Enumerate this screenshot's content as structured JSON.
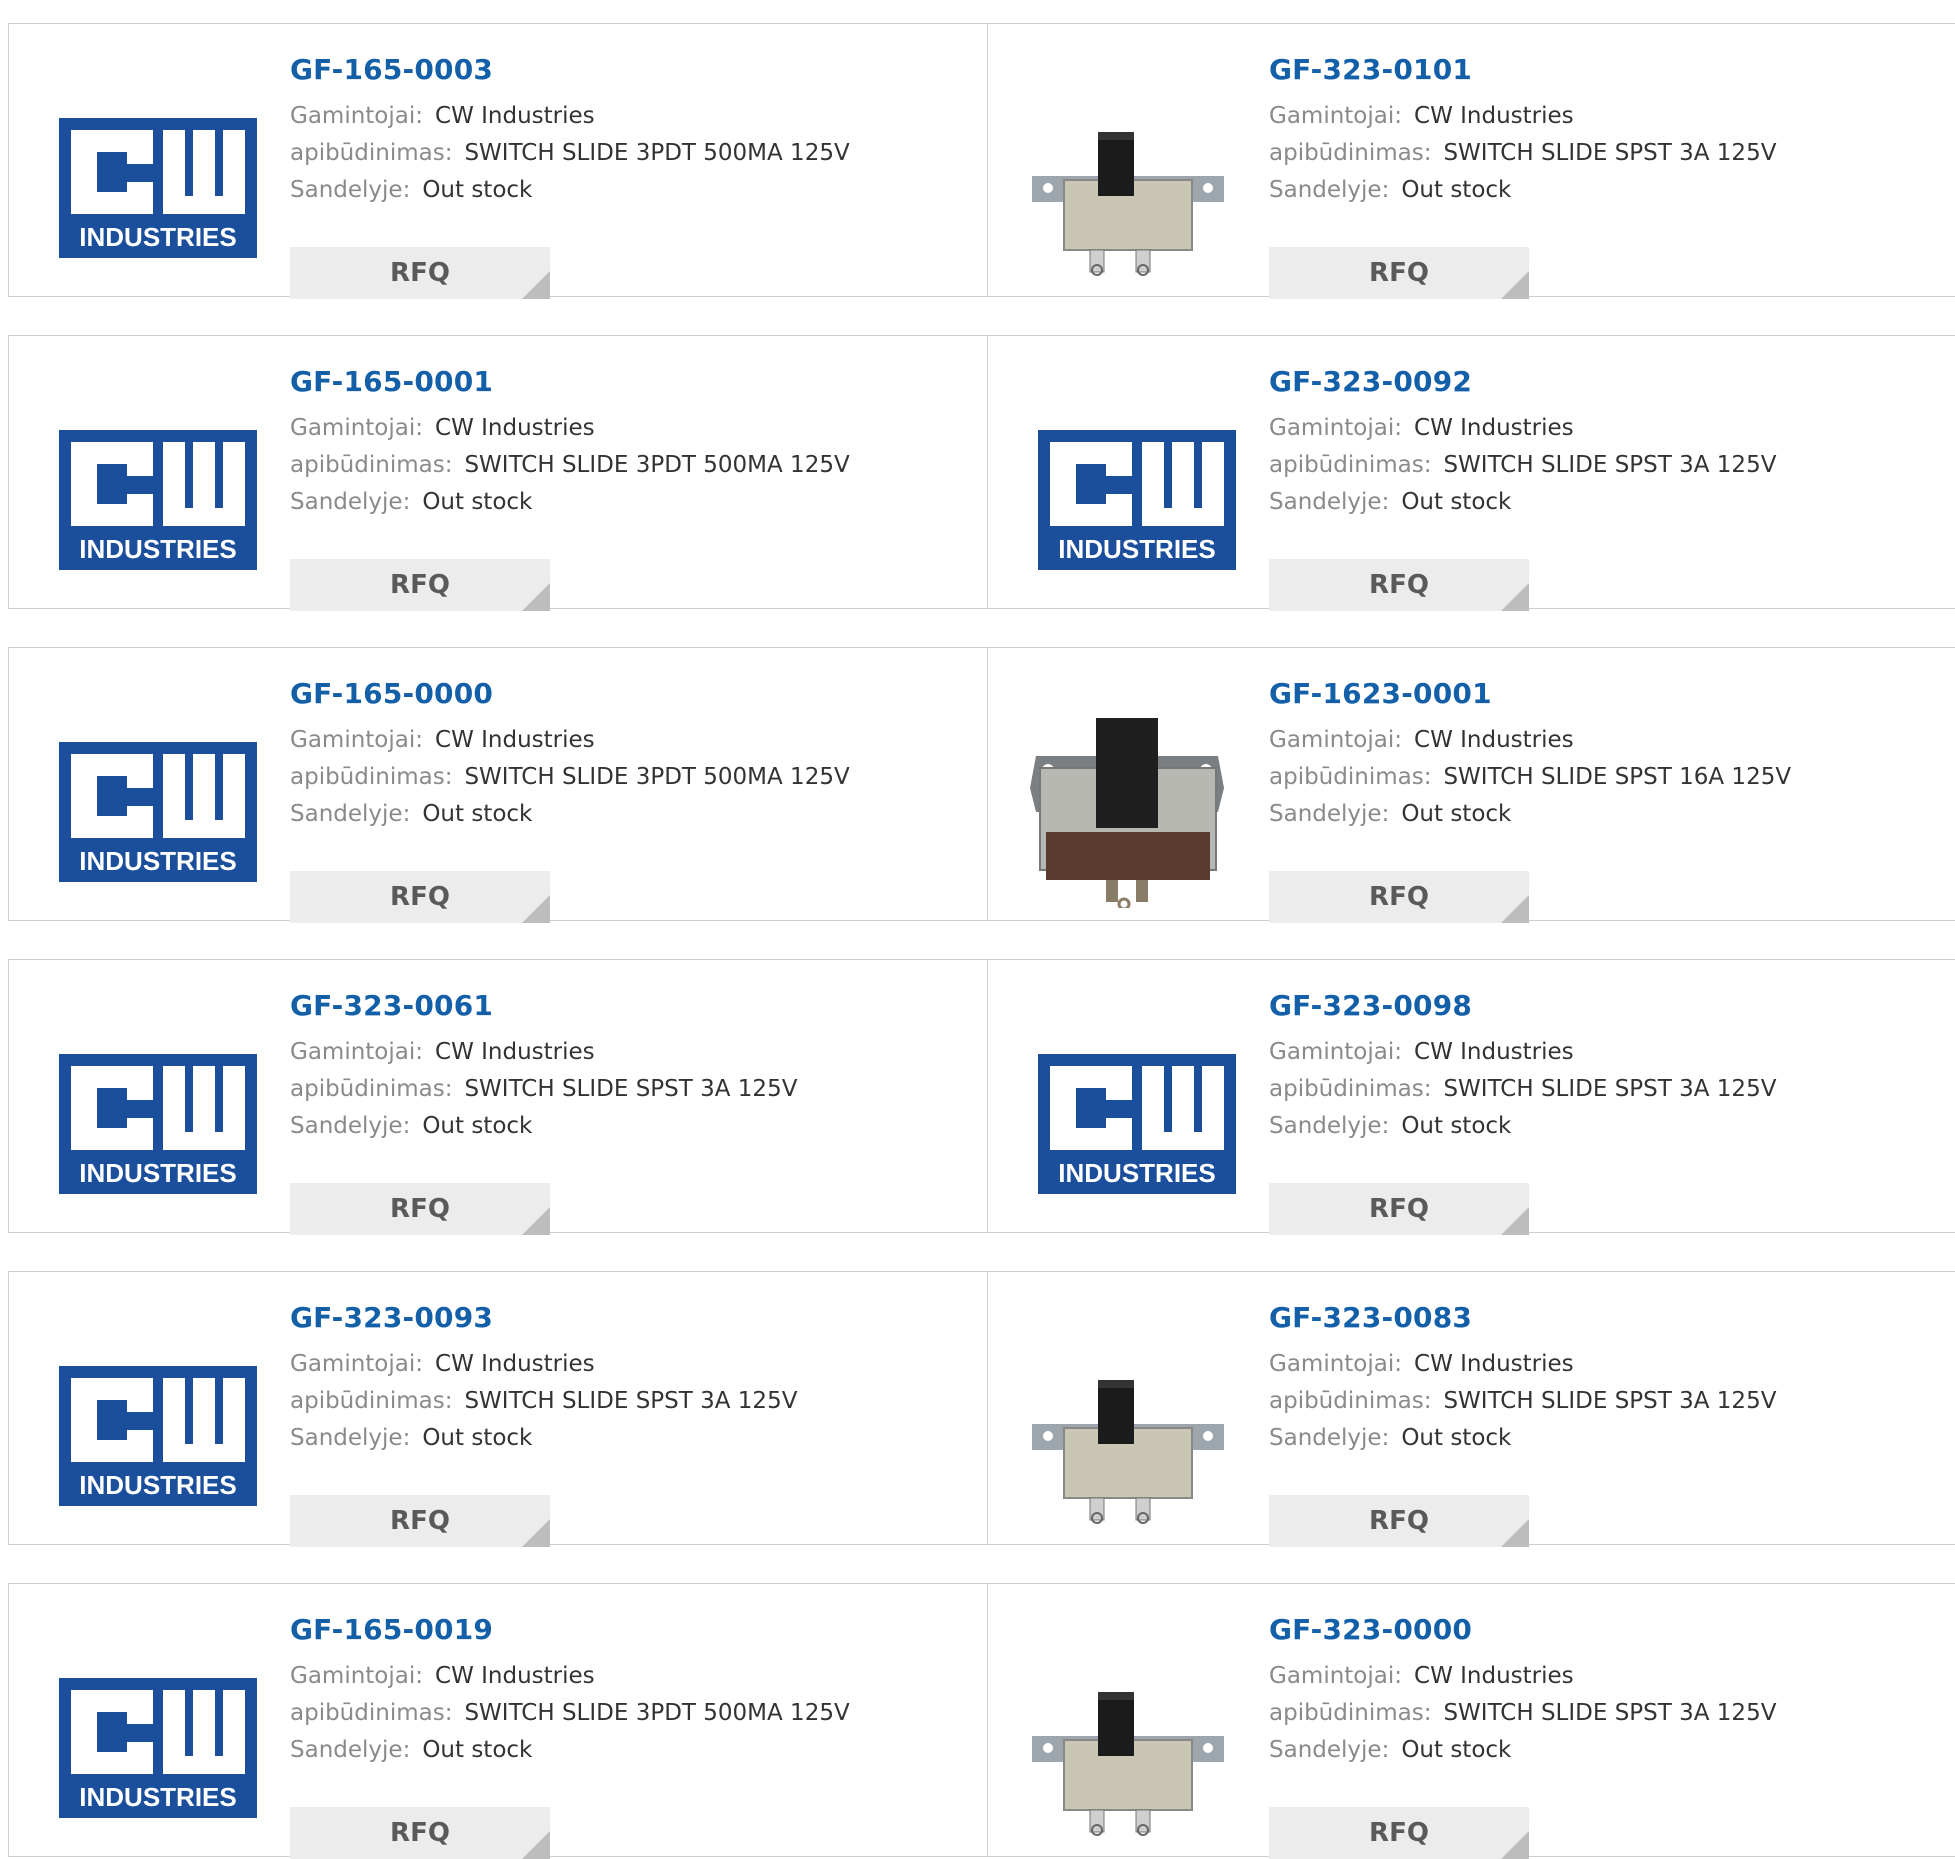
{
  "labels": {
    "manufacturer": "Gamintojai:",
    "description": "apibūdinimas:",
    "stock": "Sandelyje:",
    "rfq": "RFQ"
  },
  "logo_text": "INDUSTRIES",
  "products": [
    {
      "part": "GF-165-0003",
      "manufacturer": "CW Industries",
      "description": "SWITCH SLIDE 3PDT 500MA 125V",
      "stock": "Out stock",
      "image": "cw-industries-logo"
    },
    {
      "part": "GF-323-0101",
      "manufacturer": "CW Industries",
      "description": "SWITCH SLIDE SPST 3A 125V",
      "stock": "Out stock",
      "image": "slide-switch-photo"
    },
    {
      "part": "GF-165-0001",
      "manufacturer": "CW Industries",
      "description": "SWITCH SLIDE 3PDT 500MA 125V",
      "stock": "Out stock",
      "image": "cw-industries-logo"
    },
    {
      "part": "GF-323-0092",
      "manufacturer": "CW Industries",
      "description": "SWITCH SLIDE SPST 3A 125V",
      "stock": "Out stock",
      "image": "cw-industries-logo"
    },
    {
      "part": "GF-165-0000",
      "manufacturer": "CW Industries",
      "description": "SWITCH SLIDE 3PDT 500MA 125V",
      "stock": "Out stock",
      "image": "cw-industries-logo"
    },
    {
      "part": "GF-1623-0001",
      "manufacturer": "CW Industries",
      "description": "SWITCH SLIDE SPST 16A 125V",
      "stock": "Out stock",
      "image": "large-slide-switch-photo"
    },
    {
      "part": "GF-323-0061",
      "manufacturer": "CW Industries",
      "description": "SWITCH SLIDE SPST 3A 125V",
      "stock": "Out stock",
      "image": "cw-industries-logo"
    },
    {
      "part": "GF-323-0098",
      "manufacturer": "CW Industries",
      "description": "SWITCH SLIDE SPST 3A 125V",
      "stock": "Out stock",
      "image": "cw-industries-logo"
    },
    {
      "part": "GF-323-0093",
      "manufacturer": "CW Industries",
      "description": "SWITCH SLIDE SPST 3A 125V",
      "stock": "Out stock",
      "image": "cw-industries-logo"
    },
    {
      "part": "GF-323-0083",
      "manufacturer": "CW Industries",
      "description": "SWITCH SLIDE SPST 3A 125V",
      "stock": "Out stock",
      "image": "slide-switch-photo"
    },
    {
      "part": "GF-165-0019",
      "manufacturer": "CW Industries",
      "description": "SWITCH SLIDE 3PDT 500MA 125V",
      "stock": "Out stock",
      "image": "cw-industries-logo"
    },
    {
      "part": "GF-323-0000",
      "manufacturer": "CW Industries",
      "description": "SWITCH SLIDE SPST 3A 125V",
      "stock": "Out stock",
      "image": "slide-switch-photo"
    }
  ],
  "colors": {
    "part_link": "#1460a8",
    "logo_blue": "#1b4f9c",
    "rfq_bg": "#ececec",
    "label": "#8a8a8a",
    "value": "#333333"
  }
}
